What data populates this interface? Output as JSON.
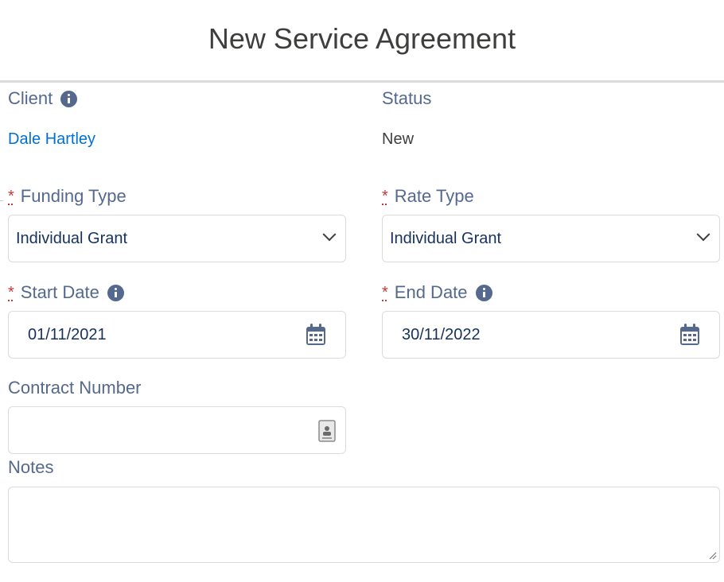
{
  "header": {
    "title": "New Service Agreement"
  },
  "client": {
    "label": "Client",
    "value": "Dale Hartley",
    "info_icon": "info-icon"
  },
  "status": {
    "label": "Status",
    "value": "New"
  },
  "funding_type": {
    "required_mark": "*",
    "label": "Funding Type",
    "value": "Individual Grant",
    "icon": "chevron-down-icon"
  },
  "rate_type": {
    "required_mark": "*",
    "label": "Rate Type",
    "value": "Individual Grant",
    "icon": "chevron-down-icon"
  },
  "start_date": {
    "required_mark": "*",
    "label": "Start Date",
    "value": "01/11/2021",
    "icon": "calendar-icon",
    "info_icon": "info-icon"
  },
  "end_date": {
    "required_mark": "*",
    "label": "End Date",
    "value": "30/11/2022",
    "icon": "calendar-icon",
    "info_icon": "info-icon"
  },
  "contract_number": {
    "label": "Contract Number",
    "value": "",
    "icon": "contact-card-icon"
  },
  "notes": {
    "label": "Notes",
    "value": ""
  },
  "colors": {
    "label": "#54698d",
    "link": "#0070d2",
    "required": "#c23934",
    "border": "#dddbda",
    "input_text": "#16325c"
  }
}
